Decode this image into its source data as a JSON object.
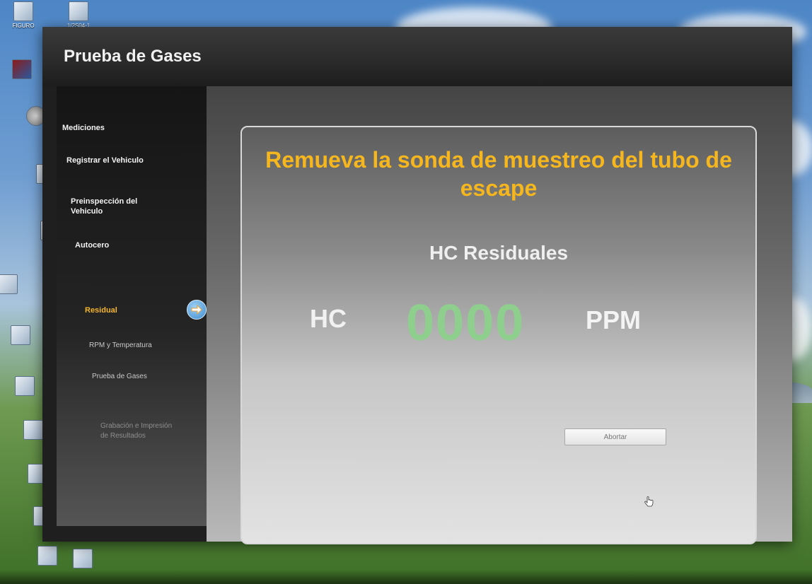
{
  "desktop": {
    "icons": [
      {
        "label": "FIGURO"
      },
      {
        "label": "1/2S04-1"
      },
      {
        "label": ""
      },
      {
        "label": ""
      },
      {
        "label": ""
      },
      {
        "label": ""
      },
      {
        "label": ""
      },
      {
        "label": ""
      },
      {
        "label": ""
      },
      {
        "label": ""
      },
      {
        "label": ""
      },
      {
        "label": ""
      },
      {
        "label": ""
      },
      {
        "label": ""
      },
      {
        "label": ""
      }
    ]
  },
  "window": {
    "title": "Prueba de Gases"
  },
  "sidebar": {
    "items": [
      {
        "label": "Mediciones",
        "state": "done"
      },
      {
        "label": "Registrar el Vehiculo",
        "state": "done"
      },
      {
        "label": "Preinspección del Vehiculo",
        "state": "done"
      },
      {
        "label": "Autocero",
        "state": "done"
      },
      {
        "label": "Residual",
        "state": "active"
      },
      {
        "label": "RPM y Temperatura",
        "state": "pending"
      },
      {
        "label": "Prueba de Gases",
        "state": "pending"
      },
      {
        "label": "Grabación e Impresión de Resultados",
        "state": "disabled"
      }
    ],
    "current_step_icon": "arrow-right-icon"
  },
  "main": {
    "instruction": "Remueva la sonda de muestreo del tubo de escape",
    "section_title": "HC Residuales",
    "reading": {
      "label": "HC",
      "value": "0000",
      "unit": "PPM"
    },
    "abort_label": "Abortar"
  },
  "colors": {
    "accent": "#f6b71e",
    "reading": "#8ecf8e",
    "active_step": "#f5b52a"
  }
}
